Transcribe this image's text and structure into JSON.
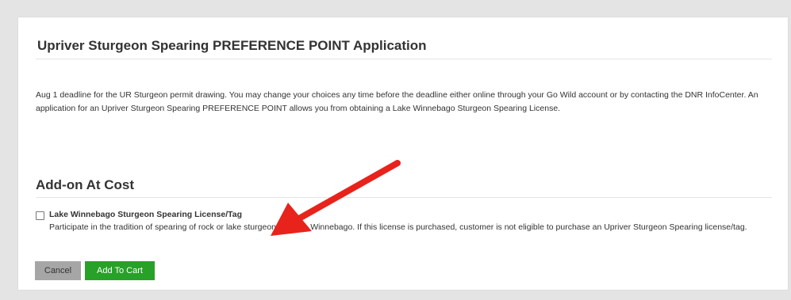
{
  "application": {
    "title": "Upriver Sturgeon Spearing PREFERENCE POINT Application",
    "description": "Aug 1 deadline for the UR Sturgeon permit drawing. You may change your choices any time before the deadline either online through your Go Wild account or by contacting the DNR InfoCenter. An application for an Upriver Sturgeon Spearing PREFERENCE POINT allows you from obtaining a Lake Winnebago Sturgeon Spearing License."
  },
  "addon": {
    "section_title": "Add-on At Cost",
    "option_label": "Lake Winnebago Sturgeon Spearing License/Tag",
    "option_description": "Participate in the tradition of spearing of rock or lake sturgeon on Lake Winnebago. If this license is purchased, customer is not eligible to purchase an Upriver Sturgeon Spearing license/tag.",
    "checked": false
  },
  "actions": {
    "cancel_label": "Cancel",
    "add_to_cart_label": "Add To Cart"
  },
  "colors": {
    "add_button": "#27a127",
    "cancel_button": "#a6a6a6",
    "annotation_arrow": "#e8231c"
  },
  "icons": {
    "annotation": "red-arrow-icon"
  }
}
